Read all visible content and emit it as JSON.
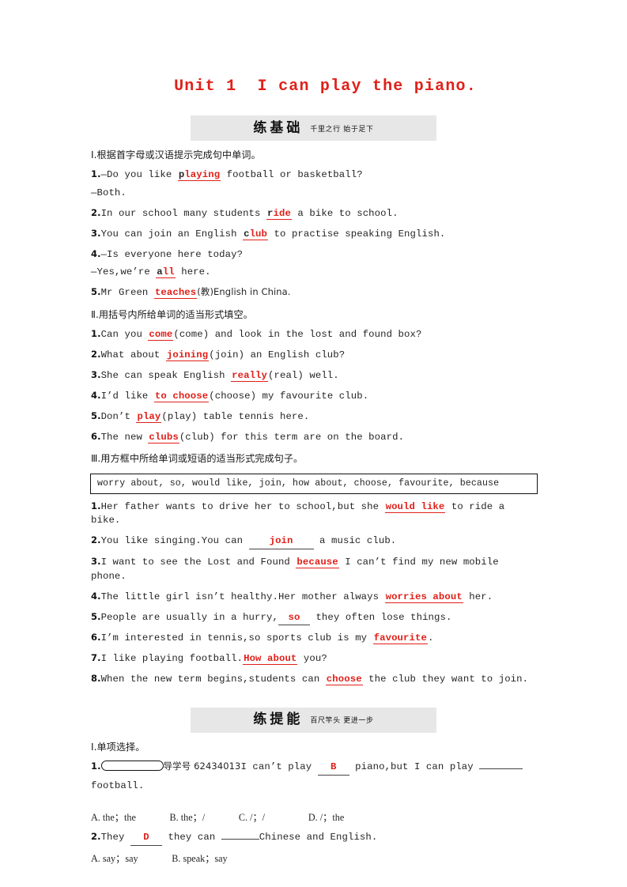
{
  "title": "Unit 1  I can play the piano.",
  "sections": [
    {
      "band_main": "练基础",
      "band_sub": "千里之行 始于足下",
      "parts": [
        {
          "heading": "Ⅰ.根据首字母或汉语提示完成句中单词。",
          "items": [
            {
              "num": "1.",
              "pre": "—Do you like ",
              "given": "p",
              "answer": "laying",
              "post": " football or basketball?",
              "extra": "—Both."
            },
            {
              "num": "2.",
              "pre": "In our school many students ",
              "given": "r",
              "answer": "ide",
              "post": " a bike to school."
            },
            {
              "num": "3.",
              "pre": "You can join an English ",
              "given": "c",
              "answer": "lub",
              "post": " to practise speaking English."
            },
            {
              "num": "4.",
              "pre": "—Is everyone here today?",
              "given": "",
              "answer": "",
              "post": "",
              "extra": "—Yes,we’re _all_ here.",
              "extra_pre": "—Yes,we’re ",
              "extra_given": "a",
              "extra_answer": "ll",
              "extra_post": " here."
            },
            {
              "num": "5.",
              "pre": "Mr Green ",
              "given": "",
              "answer": "teaches",
              "post": "(教)English in China."
            }
          ]
        },
        {
          "heading": "Ⅱ.用括号内所给单词的适当形式填空。",
          "items": [
            {
              "num": "1.",
              "pre": "Can you ",
              "answer": "come",
              "post": "(come) and look in the lost and found box?"
            },
            {
              "num": "2.",
              "pre": "What about ",
              "answer": "joining",
              "post": "(join) an English club?"
            },
            {
              "num": "3.",
              "pre": "She can speak English ",
              "answer": "really",
              "post": "(real) well."
            },
            {
              "num": "4.",
              "pre": "I’d like ",
              "answer": "to choose",
              "post": "(choose) my favourite club."
            },
            {
              "num": "5.",
              "pre": "Don’t ",
              "answer": "play",
              "post": "(play) table tennis here."
            },
            {
              "num": "6.",
              "pre": "The new ",
              "answer": "clubs",
              "post": "(club) for this term are on the board."
            }
          ]
        },
        {
          "heading": "Ⅲ.用方框中所给单词或短语的适当形式完成句子。",
          "wordbank": "worry about, so, would like, join, how about, choose, favourite, because",
          "items": [
            {
              "num": "1.",
              "pre": "Her father wants to drive her to school,but she ",
              "answer": "would like",
              "post": " to ride a bike."
            },
            {
              "num": "2.",
              "pre": "You like singing.You can ",
              "answer": "join",
              "post": " a music club.",
              "wide": true
            },
            {
              "num": "3.",
              "pre": "I want to see the Lost and Found ",
              "answer": "because",
              "post": " I can’t find my new mobile phone."
            },
            {
              "num": "4.",
              "pre": "The little girl isn’t healthy.Her mother always ",
              "answer": "worries about",
              "post": " her."
            },
            {
              "num": "5.",
              "pre": "People are usually in a hurry,",
              "answer": "so",
              "post": " they often lose things.",
              "small": true
            },
            {
              "num": "6.",
              "pre": "I’m interested in tennis,so sports club is my ",
              "answer": "favourite",
              "post": "."
            },
            {
              "num": "7.",
              "pre": "I like playing football.",
              "answer": "How about",
              "post": " you?"
            },
            {
              "num": "8.",
              "pre": "When the new term begins,students can ",
              "answer": "choose",
              "post": " the club they want to join."
            }
          ]
        }
      ]
    },
    {
      "band_main": "练提能",
      "band_sub": "百尺竿头 更进一步",
      "parts": [
        {
          "heading": "Ⅰ.单项选择。",
          "mc": [
            {
              "num": "1.",
              "pill": true,
              "guide": "导学号 62434013",
              "pre": "I can’t play ",
              "answer": "B",
              "mid": " piano,but I can play ",
              "blank": true,
              "post": "",
              "wrap": "football.",
              "options": "A. the；the              B. the；/              C. /；/                  D. /；the"
            },
            {
              "num": "2.",
              "pill": false,
              "pre": "They ",
              "answer": "D",
              "mid": " they can ",
              "blank": true,
              "post": "Chinese and English.",
              "options": "A. say；say              B. speak；say"
            }
          ]
        }
      ]
    }
  ]
}
